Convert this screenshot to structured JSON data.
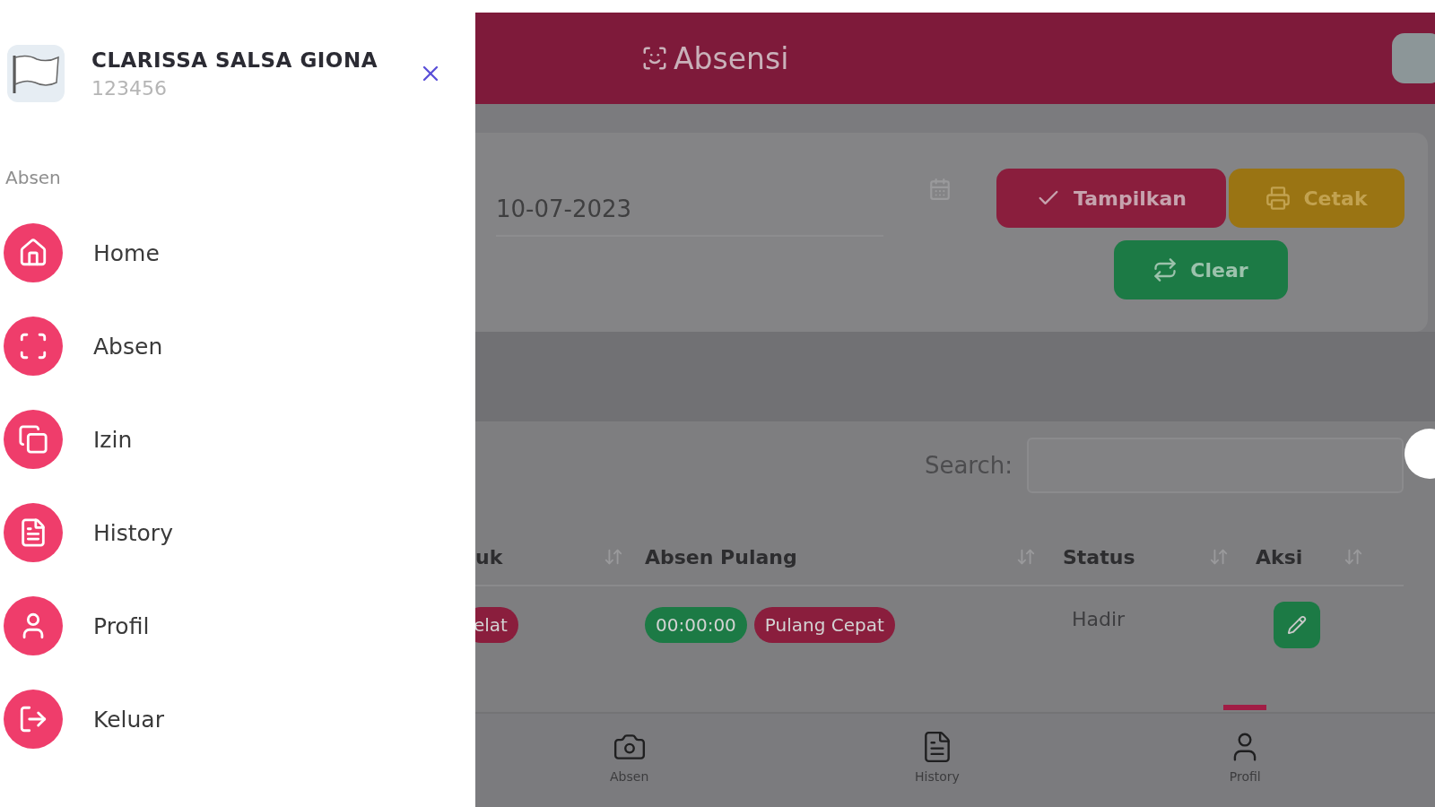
{
  "drawer": {
    "user_name": "CLARISSA SALSA GIONA",
    "user_id": "123456",
    "section_label": "Absen",
    "items": [
      {
        "label": "Home"
      },
      {
        "label": "Absen"
      },
      {
        "label": "Izin"
      },
      {
        "label": "History"
      },
      {
        "label": "Profil"
      },
      {
        "label": "Keluar"
      }
    ]
  },
  "header": {
    "title": "Absensi"
  },
  "filter": {
    "date_value": "10-07-2023",
    "buttons": [
      {
        "label": "Tampilkan",
        "kind": "show"
      },
      {
        "label": "Cetak",
        "kind": "print"
      },
      {
        "label": "Clear",
        "kind": "clear"
      }
    ]
  },
  "table": {
    "search_label": "Search:",
    "columns": [
      "uk",
      "Absen Pulang",
      "Status",
      "Aksi"
    ],
    "rows": [
      {
        "masuk_badges": [
          {
            "text": "elat",
            "color": "#8a1e3d"
          }
        ],
        "pulang_badges": [
          {
            "text": "00:00:00",
            "color": "#1c7a45"
          },
          {
            "text": "Pulang Cepat",
            "color": "#8a1e3d"
          }
        ],
        "status": "Hadir"
      }
    ]
  },
  "bottom_nav": [
    {
      "label": "Absen",
      "selected": false
    },
    {
      "label": "History",
      "selected": false
    },
    {
      "label": "Profil",
      "selected": true
    }
  ]
}
